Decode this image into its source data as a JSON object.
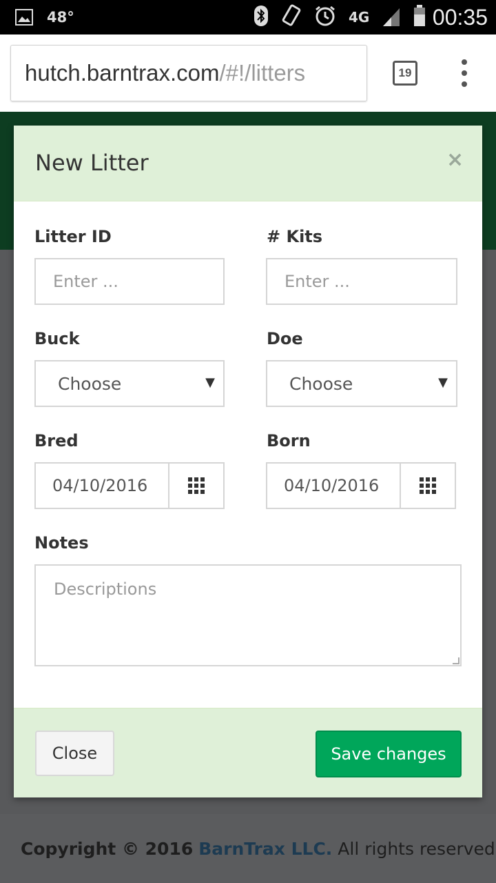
{
  "status_bar": {
    "temperature": "48°",
    "network": "4G",
    "time": "00:35"
  },
  "browser": {
    "url_host": "hutch.barntrax.com",
    "url_path": "/#!/litters",
    "tab_count": "19"
  },
  "modal": {
    "title": "New Litter",
    "close_symbol": "×",
    "fields": {
      "litter_id": {
        "label": "Litter ID",
        "placeholder": "Enter ..."
      },
      "kits": {
        "label": "# Kits",
        "placeholder": "Enter ..."
      },
      "buck": {
        "label": "Buck",
        "value": "Choose"
      },
      "doe": {
        "label": "Doe",
        "value": "Choose"
      },
      "bred": {
        "label": "Bred",
        "value": "04/10/2016"
      },
      "born": {
        "label": "Born",
        "value": "04/10/2016"
      },
      "notes": {
        "label": "Notes",
        "placeholder": "Descriptions"
      }
    },
    "buttons": {
      "close": "Close",
      "save": "Save changes"
    }
  },
  "footer": {
    "copyright": "Copyright © 2016",
    "company": "BarnTrax LLC.",
    "rights": "All rights reserved."
  },
  "colors": {
    "header_bg": "#dff0d8",
    "save_button": "#00a65a",
    "page_header": "#0d3d21",
    "overlay": "#58595b"
  }
}
